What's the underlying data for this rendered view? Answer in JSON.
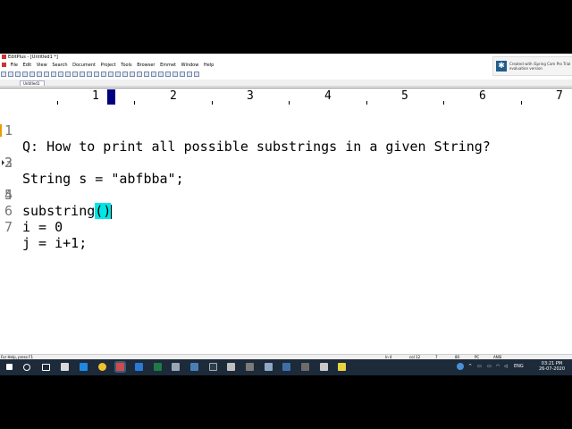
{
  "window": {
    "title": "EditPlus - [Untitled1 *]"
  },
  "menu": [
    "File",
    "Edit",
    "View",
    "Search",
    "Document",
    "Project",
    "Tools",
    "Browser",
    "Emmet",
    "Window",
    "Help"
  ],
  "tab": {
    "label": "Untitled1"
  },
  "ruler": {
    "numbers": [
      "1",
      "2",
      "3",
      "4",
      "5",
      "6",
      "7"
    ]
  },
  "editor": {
    "lines": [
      {
        "num": "1",
        "text": "Q: How to print all possible substrings in a given String?"
      },
      {
        "num": "2",
        "text": "String s = \"abfbba\";"
      },
      {
        "num": "3",
        "text": ""
      },
      {
        "num": "4",
        "text": "substring",
        "highlight": "()"
      },
      {
        "num": "5",
        "text": ""
      },
      {
        "num": "6",
        "text": "i = 0"
      },
      {
        "num": "7",
        "text": "j = i+1;"
      }
    ]
  },
  "status": {
    "help": "For Help, press F1",
    "ln": "ln 4",
    "col": "col 12",
    "num7": "7",
    "num80": "80",
    "pc": "PC",
    "ansi": "ANSI"
  },
  "notice": {
    "line1": "Created with iSpring Cam Pro Trial",
    "line2": "evaluation version"
  },
  "taskbar": {
    "lang": "ENG",
    "time": "03:21 PM",
    "date": "26-07-2020"
  },
  "colors": {
    "highlight": "#00e5e5",
    "ruler_cursor": "#000080",
    "taskbar": "#1c2a3a"
  }
}
